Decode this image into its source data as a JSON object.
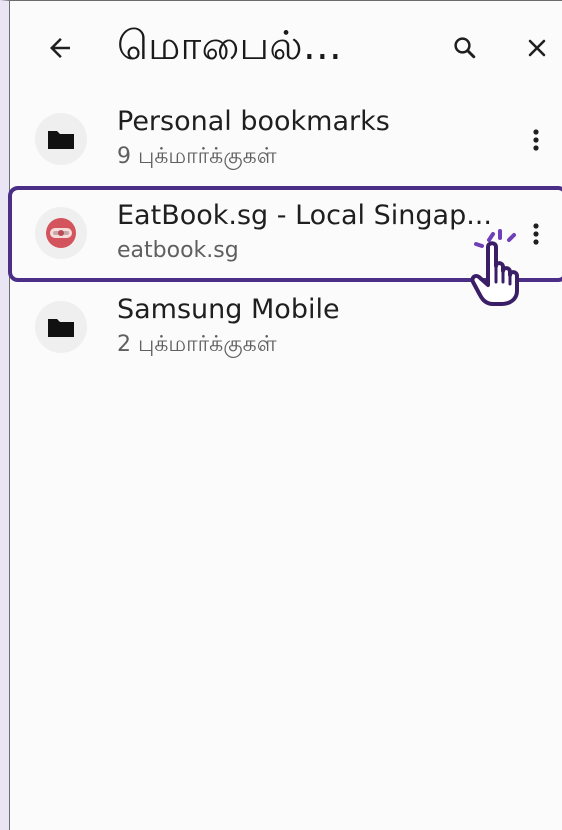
{
  "header": {
    "title": "மொபைல்...",
    "back_icon": "arrow-left-icon",
    "search_icon": "search-icon",
    "close_icon": "close-icon"
  },
  "items": [
    {
      "title": "Personal bookmarks",
      "subtitle": "9 புக்மார்க்குகள்",
      "icon": "folder-icon"
    },
    {
      "title": "EatBook.sg - Local Singap...",
      "subtitle": "eatbook.sg",
      "icon": "site-favicon-icon"
    },
    {
      "title": "Samsung Mobile",
      "subtitle": "2 புக்மார்க்குகள்",
      "icon": "folder-icon"
    }
  ],
  "colors": {
    "selection": "#4b2f87",
    "background": "#fbfbfb",
    "subtitle": "#5f5f5f"
  }
}
